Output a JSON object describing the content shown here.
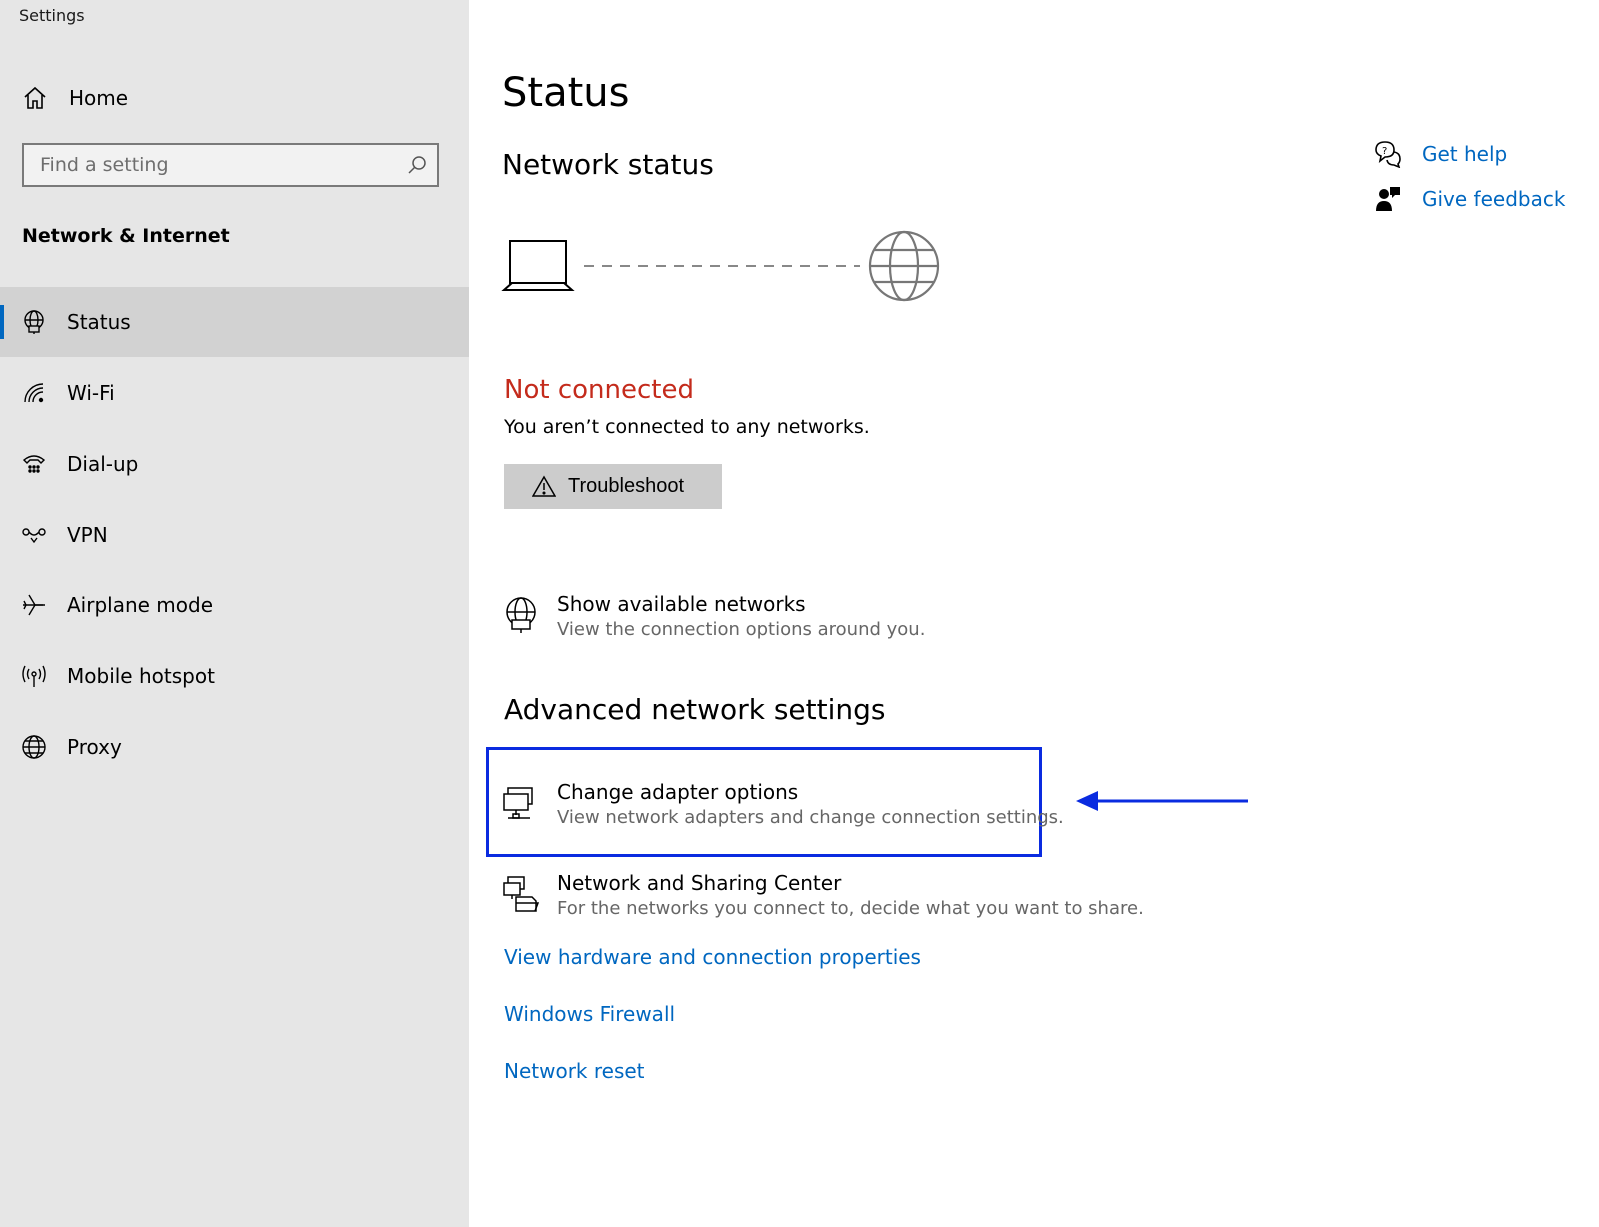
{
  "app": {
    "title": "Settings"
  },
  "sidebar": {
    "home_label": "Home",
    "search_placeholder": "Find a setting",
    "section_label": "Network & Internet",
    "items": [
      {
        "label": "Status",
        "icon": "status-globe-icon",
        "active": true
      },
      {
        "label": "Wi-Fi",
        "icon": "wifi-icon"
      },
      {
        "label": "Dial-up",
        "icon": "dialup-icon"
      },
      {
        "label": "VPN",
        "icon": "vpn-icon"
      },
      {
        "label": "Airplane mode",
        "icon": "airplane-icon"
      },
      {
        "label": "Mobile hotspot",
        "icon": "hotspot-icon"
      },
      {
        "label": "Proxy",
        "icon": "globe-icon"
      }
    ]
  },
  "main": {
    "page_title": "Status",
    "network_status_heading": "Network status",
    "connection_state": "Not connected",
    "connection_desc": "You aren’t connected to any networks.",
    "troubleshoot_label": "Troubleshoot",
    "show_networks": {
      "title": "Show available networks",
      "subtitle": "View the connection options around you."
    },
    "advanced_heading": "Advanced network settings",
    "change_adapter": {
      "title": "Change adapter options",
      "subtitle": "View network adapters and change connection settings."
    },
    "sharing_center": {
      "title": "Network and Sharing Center",
      "subtitle": "For the networks you connect to, decide what you want to share."
    },
    "links": [
      "View hardware and connection properties",
      "Windows Firewall",
      "Network reset"
    ]
  },
  "help": {
    "get_help": "Get help",
    "give_feedback": "Give feedback"
  },
  "colors": {
    "accent": "#0067c0",
    "error": "#c42b1c",
    "highlight": "#0a2be0",
    "sidebar_bg": "#e6e6e6"
  }
}
